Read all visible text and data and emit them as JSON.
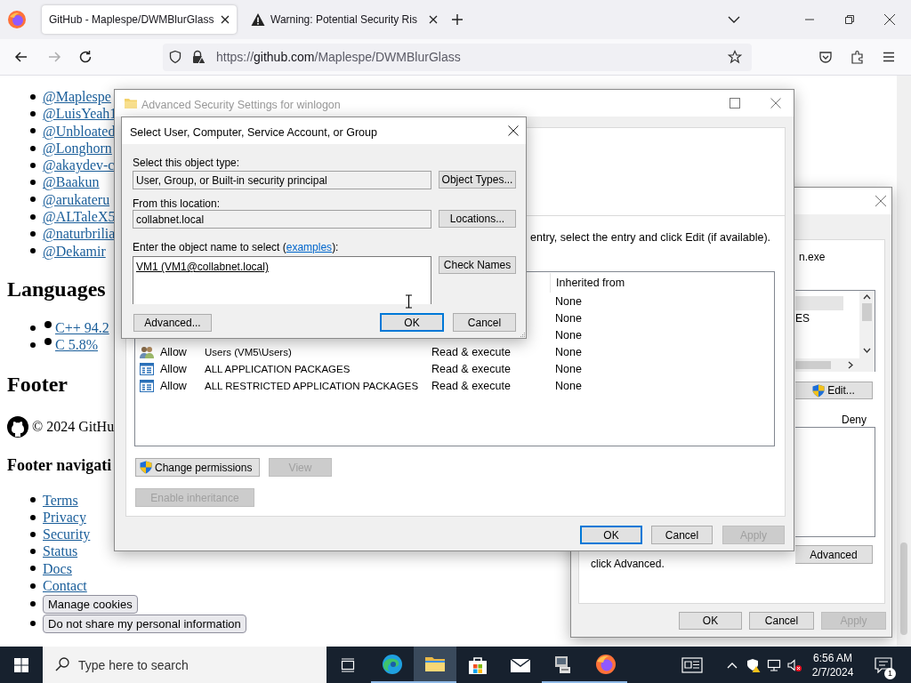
{
  "browser": {
    "tabs": [
      {
        "title": "GitHub - Maplespe/DWMBlurGlass",
        "selected": true,
        "kind": "page"
      },
      {
        "title": "Warning: Potential Security Ris",
        "selected": false,
        "kind": "warning"
      }
    ],
    "url": {
      "scheme": "https://",
      "host": "github.com",
      "path": "/Maplespe/DWMBlurGlass"
    },
    "forward_disabled": true
  },
  "page": {
    "contributors": [
      "@Maplespe",
      "@LuisYeah1",
      "@Unbloated",
      "@Longhorn",
      "@akaydev-c",
      "@Baakun",
      "@arukateru",
      "@ALTaleX5",
      "@naturbrilia",
      "@Dekamir"
    ],
    "languages_heading": "Languages",
    "languages": [
      "C++ 94.2",
      "C 5.8%"
    ],
    "footer_heading": "Footer",
    "copyright": "© 2024 GitHu",
    "footer_nav_heading": "Footer navigati",
    "footer_links": [
      "Terms",
      "Privacy",
      "Security",
      "Status",
      "Docs",
      "Contact"
    ],
    "footer_buttons": [
      "Manage cookies",
      "Do not share my personal information"
    ]
  },
  "permissions_window": {
    "file_text": "n.exe",
    "list_item": "ES",
    "edit_button": "Edit...",
    "deny_header": "Deny",
    "note": "click Advanced.",
    "advanced_button": "Advanced",
    "buttons": [
      {
        "label": "OK",
        "disabled": false,
        "default": false
      },
      {
        "label": "Cancel",
        "disabled": false,
        "default": false
      },
      {
        "label": "Apply",
        "disabled": true,
        "default": false
      }
    ]
  },
  "advanced_window": {
    "title": "Advanced Security Settings for winlogon",
    "hint": "entry, select the entry and click Edit (if available).",
    "inherited_header": "Inherited from",
    "entries": [
      {
        "inherited": "None"
      },
      {
        "inherited": "None"
      },
      {
        "inherited": "None"
      },
      {
        "kind": "users",
        "type": "Allow",
        "principal": "Users (VM5\\Users)",
        "access": "Read & execute",
        "inherited": "None"
      },
      {
        "kind": "package",
        "type": "Allow",
        "principal": "ALL APPLICATION PACKAGES",
        "access": "Read & execute",
        "inherited": "None"
      },
      {
        "kind": "package",
        "type": "Allow",
        "principal": "ALL RESTRICTED APPLICATION PACKAGES",
        "access": "Read & execute",
        "inherited": "None"
      }
    ],
    "action_buttons": [
      {
        "label": "Change permissions",
        "disabled": false,
        "elevated": true
      },
      {
        "label": "View",
        "disabled": true,
        "elevated": false
      },
      {
        "label": "Enable inheritance",
        "disabled": true,
        "elevated": false
      }
    ],
    "buttons": [
      {
        "label": "OK",
        "disabled": false,
        "default": true
      },
      {
        "label": "Cancel",
        "disabled": false,
        "default": false
      },
      {
        "label": "Apply",
        "disabled": true,
        "default": false
      }
    ]
  },
  "select_dialog": {
    "title": "Select User, Computer, Service Account, or Group",
    "object_type_label": "Select this object type:",
    "object_type": "User, Group, or Built-in security principal",
    "object_types_button": "Object Types...",
    "location_label": "From this location:",
    "location": "collabnet.local",
    "locations_button": "Locations...",
    "name_label": "Enter the object name to select (",
    "examples_link": "examples",
    "name_label_end": "):",
    "object_name": "VM1 (VM1@collabnet.local)",
    "check_names_button": "Check Names",
    "advanced_button": "Advanced...",
    "buttons": [
      {
        "label": "OK",
        "default": true
      },
      {
        "label": "Cancel",
        "default": false
      }
    ]
  },
  "taskbar": {
    "search_placeholder": "Type here to search",
    "apps": [
      {
        "kind": "taskview",
        "running": false,
        "selected": false
      },
      {
        "kind": "edge",
        "running": true,
        "selected": false
      },
      {
        "kind": "explorer",
        "running": true,
        "selected": true
      },
      {
        "kind": "store",
        "running": false,
        "selected": false
      },
      {
        "kind": "mail",
        "running": false,
        "selected": false
      },
      {
        "kind": "app",
        "running": true,
        "selected": false
      },
      {
        "kind": "firefox",
        "running": true,
        "selected": false
      }
    ],
    "time": "6:56 AM",
    "date": "2/7/2024",
    "notification_count": "1"
  }
}
